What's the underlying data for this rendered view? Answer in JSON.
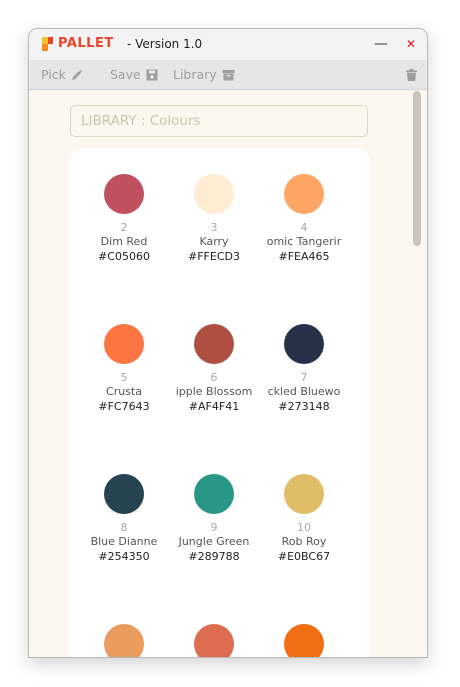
{
  "window": {
    "app_name": "PALLET",
    "title": "- Version 1.0",
    "minimize_label": "—",
    "close_label": "✕"
  },
  "toolbar": {
    "pick_label": "Pick",
    "save_label": "Save",
    "library_label": "Library"
  },
  "search": {
    "placeholder": "LIBRARY : Colours"
  },
  "swatches": [
    {
      "num": "2",
      "name": "Dim Red",
      "hex": "#C05060",
      "color": "#C05060"
    },
    {
      "num": "3",
      "name": "Karry",
      "hex": "#FFECD3",
      "color": "#FFECD3"
    },
    {
      "num": "4",
      "name": "omic Tangerir",
      "hex": "#FEA465",
      "color": "#FEA465"
    },
    {
      "num": "5",
      "name": "Crusta",
      "hex": "#FC7643",
      "color": "#FC7643"
    },
    {
      "num": "6",
      "name": "ipple Blossom",
      "hex": "#AF4F41",
      "color": "#AF4F41"
    },
    {
      "num": "7",
      "name": "ckled Bluewo",
      "hex": "#273148",
      "color": "#273148"
    },
    {
      "num": "8",
      "name": "Blue Dianne",
      "hex": "#254350",
      "color": "#254350"
    },
    {
      "num": "9",
      "name": "Jungle Green",
      "hex": "#289788",
      "color": "#289788"
    },
    {
      "num": "10",
      "name": "Rob Roy",
      "hex": "#E0BC67",
      "color": "#E0BC67"
    },
    {
      "num": "",
      "name": "",
      "hex": "",
      "color": "#EA9C5E"
    },
    {
      "num": "",
      "name": "",
      "hex": "",
      "color": "#DE6C50"
    },
    {
      "num": "",
      "name": "",
      "hex": "",
      "color": "#EF6E14"
    }
  ]
}
